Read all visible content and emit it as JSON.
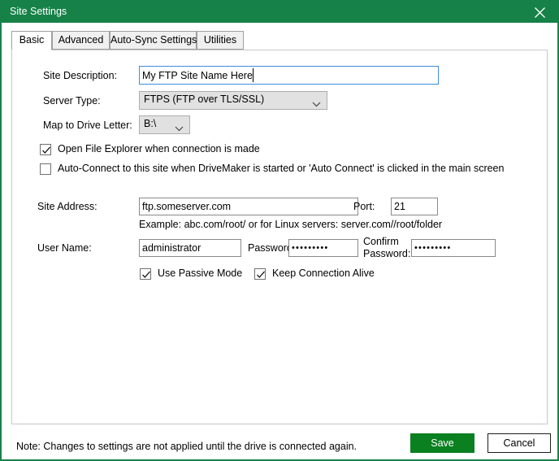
{
  "window": {
    "title": "Site Settings",
    "close_icon": "close-icon",
    "accent_green": "#178248",
    "save_green": "#0a8020"
  },
  "tabs": [
    {
      "label": "Basic",
      "active": true
    },
    {
      "label": "Advanced",
      "active": false
    },
    {
      "label": "Auto-Sync Settings",
      "active": false
    },
    {
      "label": "Utilities",
      "active": false
    }
  ],
  "basic": {
    "site_description": {
      "label": "Site Description:",
      "value": "My FTP Site Name Here",
      "placeholder": "",
      "focused": true
    },
    "server_type": {
      "label": "Server Type:",
      "value": "FTPS (FTP over TLS/SSL)",
      "chevron_icon": "chevron-down-icon"
    },
    "map_to_drive_letter": {
      "label": "Map to Drive Letter:",
      "value": "B:\\",
      "chevron_icon": "chevron-down-icon"
    },
    "open_file_explorer": {
      "label": "Open File Explorer when connection is made",
      "checked": true
    },
    "auto_connect": {
      "label": "Auto-Connect to this site when DriveMaker is started or 'Auto Connect' is clicked in the main screen",
      "checked": false
    },
    "site_address": {
      "label": "Site Address:",
      "value": "ftp.someserver.com",
      "placeholder": ""
    },
    "port": {
      "label": "Port:",
      "value": "21",
      "placeholder": ""
    },
    "example_hint": "Example: abc.com/root/ or for Linux servers: server.com//root/folder",
    "user_name": {
      "label": "User Name:",
      "value": "administrator",
      "placeholder": ""
    },
    "password": {
      "label": "Password:",
      "value": "•••••••••",
      "placeholder": ""
    },
    "confirm_password": {
      "label_line1": "Confirm",
      "label_line2": "Password:",
      "value": "•••••••••",
      "placeholder": ""
    },
    "use_passive_mode": {
      "label": "Use Passive Mode",
      "checked": true
    },
    "keep_connection_alive": {
      "label": "Keep Connection Alive",
      "checked": true
    }
  },
  "footer": {
    "note": "Note: Changes to settings are not applied until the drive is connected again.",
    "save_label": "Save",
    "cancel_label": "Cancel"
  }
}
